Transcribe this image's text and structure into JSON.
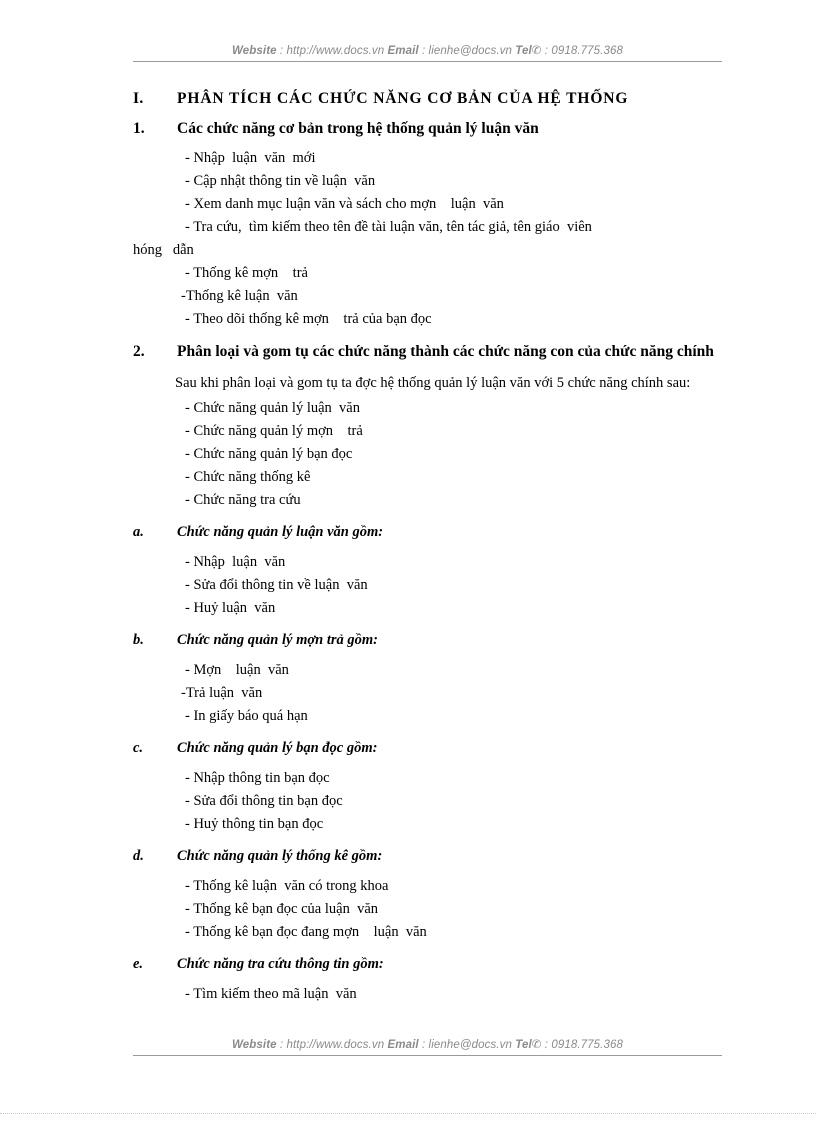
{
  "header": {
    "website_label": "Website",
    "website_value": " : http://www.docs.vn  ",
    "email_label": "Email",
    "email_value": "  : lienhe@docs.vn   ",
    "tel_label": "Tel",
    "tel_icon": "telephone-icon",
    "tel_glyph": "✆",
    "tel_value": " : 0918.775.368"
  },
  "footer": {
    "website_label": "Website",
    "website_value": " : http://www.docs.vn  ",
    "email_label": "Email",
    "email_value": "  : lienhe@docs.vn   ",
    "tel_label": "Tel",
    "tel_icon": "telephone-icon",
    "tel_glyph": "✆",
    "tel_value": " : 0918.775.368"
  },
  "sections": {
    "roman_1": {
      "marker": "I.",
      "title": "PHÂN TÍCH CÁC CHỨC NĂNG CƠ BẢN CỦA HỆ THỐNG"
    },
    "num_1": {
      "marker": "1.",
      "title": "Các chức năng cơ bản trong hệ thống quản lý luận văn",
      "items": [
        "- Nhập  luận  văn  mới",
        "- Cập nhật thông tin về luận  văn",
        "- Xem danh mục luận văn và sách cho mợn    luận  văn",
        "- Tra cứu,  tìm kiếm theo tên đề tài luận văn, tên tác giả, tên giáo  viên"
      ],
      "continuation": "hóng   dẫn",
      "items2": [
        "- Thống kê mợn    trả",
        "-Thống kê luận  văn",
        "- Theo dõi thống kê mợn    trả của bạn đọc"
      ]
    },
    "num_2": {
      "marker": "2.",
      "title": "Phân loại và gom tụ các chức năng thành các chức năng con của chức năng chính",
      "paragraph": "Sau  khi  phân  loại  và  gom  tụ  ta  đợc    hệ  thống  quản  lý  luận  văn  với  5 chức năng chính sau:",
      "items": [
        "- Chức năng quản lý luận  văn",
        "- Chức năng quản lý mợn    trả",
        "- Chức năng quản lý bạn đọc",
        "- Chức năng thống kê",
        "- Chức năng tra cứu"
      ]
    },
    "alpha_a": {
      "marker": "a.",
      "title": "Chức năng quản lý luận văn gồm:",
      "items": [
        "- Nhập  luận  văn",
        "- Sửa đổi thông tin về luận  văn",
        "- Huỷ luận  văn"
      ]
    },
    "alpha_b": {
      "marker": "b.",
      "title": "Chức  năng  quản lý mợn     trả gồm:",
      "items": [
        "- Mợn    luận  văn",
        "-Trả luận  văn",
        "- In giấy báo quá hạn"
      ]
    },
    "alpha_c": {
      "marker": "c.",
      "title": "Chức năng quản lý bạn đọc gồm:",
      "items": [
        "- Nhập thông tin bạn đọc",
        "- Sửa đổi thông tin bạn đọc",
        "- Huỷ thông tin bạn đọc"
      ]
    },
    "alpha_d": {
      "marker": "d.",
      "title": "Chức năng quản lý thống kê gồm:",
      "items": [
        "- Thống kê luận  văn có trong khoa",
        "- Thống kê bạn đọc của luận  văn",
        "- Thống kê bạn đọc đang mợn    luận  văn"
      ]
    },
    "alpha_e": {
      "marker": "e.",
      "title": "Chức năng tra cứu thông tin gồm:",
      "items": [
        "- Tìm kiếm theo mã luận  văn"
      ]
    }
  }
}
